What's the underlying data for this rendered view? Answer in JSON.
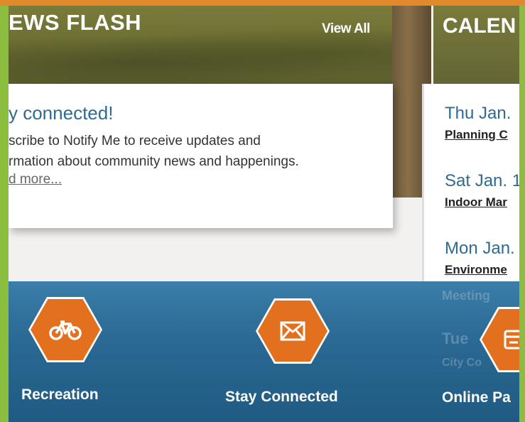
{
  "news_flash": {
    "title": "EWS FLASH",
    "view_all": "View All",
    "card": {
      "title": "y connected!",
      "body_line1": "scribe to Notify Me to receive updates and",
      "body_line2": "rmation about community news and happenings.",
      "read_more": "d more..."
    }
  },
  "calendar": {
    "title": "CALEN",
    "items": [
      {
        "date": "Thu Jan.",
        "event": "Planning C"
      },
      {
        "date": "Sat Jan. 1",
        "event": "Indoor Mar"
      },
      {
        "date": "Mon Jan.",
        "event": "Environme"
      }
    ],
    "faded": [
      "Meeting",
      "Tue",
      "City Co"
    ]
  },
  "quick_links": [
    {
      "label": "Recreation",
      "icon": "bicycle-icon"
    },
    {
      "label": "Stay Connected",
      "icon": "envelope-icon"
    },
    {
      "label": "Online Pa",
      "icon": "payment-card-icon"
    }
  ],
  "colors": {
    "accent_orange": "#e2701e",
    "link_blue": "#2f6a93",
    "band_blue": "#2b6a94",
    "header_olive": "#6a6c32"
  }
}
